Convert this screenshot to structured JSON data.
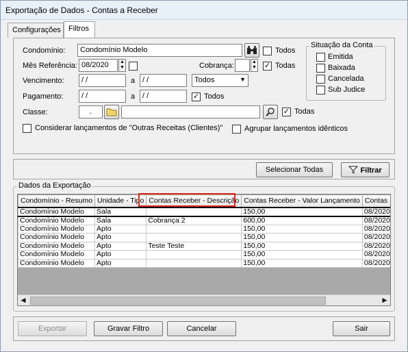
{
  "window": {
    "title": "Exportação de Dados - Contas a Receber"
  },
  "tabs": [
    {
      "label": "Configurações"
    },
    {
      "label": "Filtros"
    }
  ],
  "filters": {
    "condominio": {
      "label": "Condomínio:",
      "value": "Condomínio Modelo",
      "todos_label": "Todos"
    },
    "mes_referencia": {
      "label": "Mês Referência:",
      "value": "08/2020",
      "todos_label": "Todas"
    },
    "cobranca": {
      "label": "Cobrança:",
      "value": "",
      "todos_label": "Todas"
    },
    "vencimento": {
      "label": "Vencimento:",
      "from": " / /",
      "sep": "a",
      "to": " / /",
      "select_value": "Todos"
    },
    "pagamento": {
      "label": "Pagamento:",
      "from": " / /",
      "sep": "a",
      "to": " / /",
      "todos_label": "Todos"
    },
    "classe": {
      "label": "Classe:",
      "code": ".",
      "desc": "",
      "todos_label": "Todas"
    },
    "outras_receitas_label": "Considerar lançamentos de \"Outras Receitas (Clientes)\"",
    "agrupar_label": "Agrupar lançamentos idênticos",
    "situacao": {
      "title": "Situação da Conta",
      "options": [
        "Emitida",
        "Baixada",
        "Cancelada",
        "Sub Judice"
      ]
    }
  },
  "actions": {
    "select_all": "Selecionar Todas",
    "filter": "Filtrar"
  },
  "export": {
    "title": "Dados da Exportação",
    "columns": [
      "Condomínio - Resumo",
      "Unidade - Tipo",
      "Contas Receber - Descrição",
      "Contas Receber - Valor Lançamento",
      "Contas R"
    ],
    "rows": [
      [
        "Condomínio Modelo",
        "Sala",
        "",
        "150,00",
        "08/2020"
      ],
      [
        "Condomínio Modelo",
        "Sala",
        "Cobrança 2",
        "600,00",
        "08/2020"
      ],
      [
        "Condomínio Modelo",
        "Apto",
        "",
        "150,00",
        "08/2020"
      ],
      [
        "Condomínio Modelo",
        "Apto",
        "",
        "150,00",
        "08/2020"
      ],
      [
        "Condomínio Modelo",
        "Apto",
        "Teste Teste",
        "150,00",
        "08/2020"
      ],
      [
        "Condomínio Modelo",
        "Apto",
        "",
        "150,00",
        "08/2020"
      ],
      [
        "Condomínio Modelo",
        "Apto",
        "",
        "150,00",
        "08/2020"
      ]
    ]
  },
  "footer": {
    "exportar": "Exportar",
    "gravar_filtro": "Gravar Filtro",
    "cancelar": "Cancelar",
    "sair": "Sair"
  },
  "colors": {
    "highlight": "#d9261c",
    "title_bg": "#e8f0f8"
  }
}
